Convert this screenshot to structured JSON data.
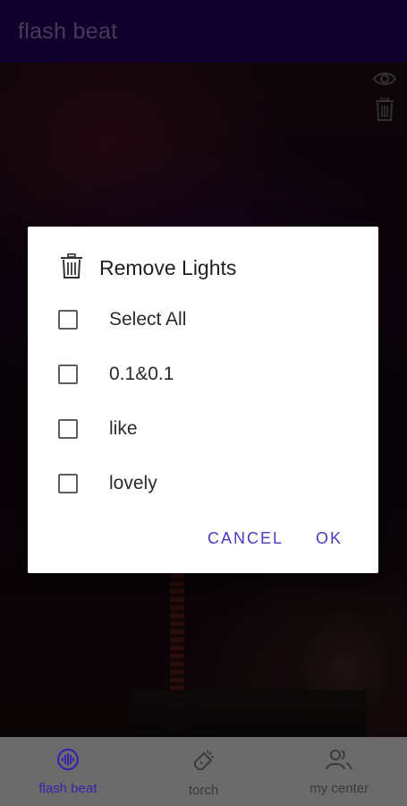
{
  "app": {
    "title": "flash beat"
  },
  "side_icons": {
    "eye": "eye-icon",
    "trash": "trash-icon"
  },
  "dialog": {
    "title": "Remove Lights",
    "title_icon": "trash-icon",
    "options": [
      {
        "label": "Select All",
        "checked": false
      },
      {
        "label": "0.1&0.1",
        "checked": false
      },
      {
        "label": "like",
        "checked": false
      },
      {
        "label": "lovely",
        "checked": false
      }
    ],
    "cancel_label": "CANCEL",
    "ok_label": "OK"
  },
  "bottom_nav": {
    "items": [
      {
        "label": "flash beat",
        "icon": "flash-beat-icon",
        "active": true
      },
      {
        "label": "torch",
        "icon": "flashlight-icon",
        "active": false
      },
      {
        "label": "my center",
        "icon": "people-icon",
        "active": false
      }
    ]
  },
  "colors": {
    "appbar_bg": "#1e0050",
    "accent": "#4a3bc4",
    "nav_active": "#3b22a8",
    "nav_bg": "#6b6b6b"
  }
}
